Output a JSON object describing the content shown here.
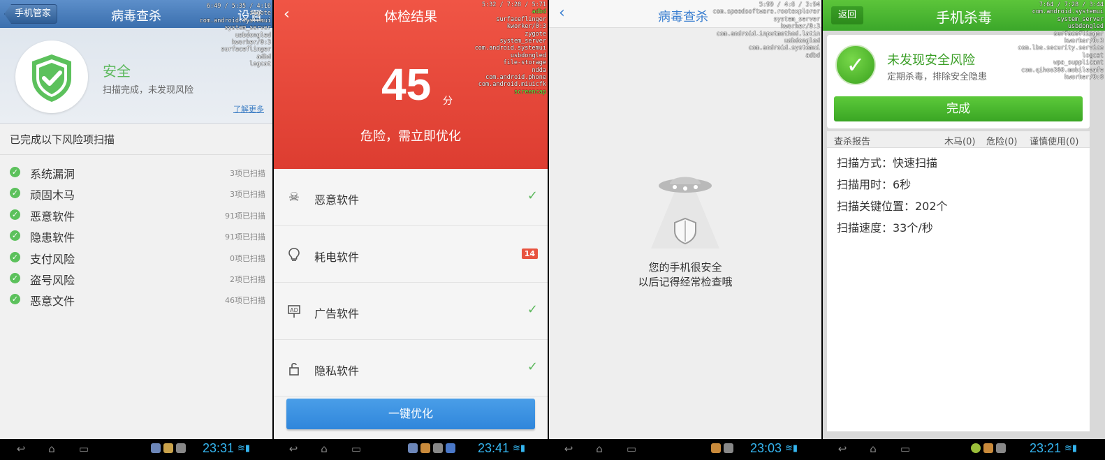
{
  "screen1": {
    "header": {
      "back_label": "手机管家",
      "title": "病毒查杀",
      "settings_label": "设置"
    },
    "debug": [
      "6:49 / 5:35 / 4:16",
      "zygote",
      "com.android.systemui",
      "system_server",
      "usbdongled",
      "kworker/0:3",
      "surfaceflinger",
      "adbd",
      "logcat"
    ],
    "status_title": "安全",
    "status_sub": "扫描完成，未发现风险",
    "learn_more": "了解更多",
    "section_title": "已完成以下风险项扫描",
    "items": [
      {
        "name": "系统漏洞",
        "count": "3项已扫描"
      },
      {
        "name": "顽固木马",
        "count": "3项已扫描"
      },
      {
        "name": "恶意软件",
        "count": "91项已扫描"
      },
      {
        "name": "隐患软件",
        "count": "91项已扫描"
      },
      {
        "name": "支付风险",
        "count": "0项已扫描"
      },
      {
        "name": "盗号风险",
        "count": "2项已扫描"
      },
      {
        "name": "恶意文件",
        "count": "46项已扫描"
      }
    ],
    "clock": "23:31"
  },
  "screen2": {
    "title": "体检结果",
    "debug": [
      "5:32 / 7:28 / 5:71",
      "adbd",
      "surfaceflinger",
      "kworker/0:3",
      "zygote",
      "system_server",
      "com.android.systemui",
      "usbdongled",
      "file-storage",
      "ndda",
      "com.android.phone",
      "com.android.miuicfk",
      "screencap"
    ],
    "score": "45",
    "score_unit": "分",
    "status": "危险，需立即优化",
    "rows": [
      {
        "name": "恶意软件",
        "icon": "skull-icon",
        "glyph": "☠",
        "state": "ok"
      },
      {
        "name": "耗电软件",
        "icon": "bulb-icon",
        "glyph": "💡",
        "state": "badge",
        "badge": "14"
      },
      {
        "name": "广告软件",
        "icon": "ad-sign-icon",
        "glyph": "⚑",
        "state": "ok"
      },
      {
        "name": "隐私软件",
        "icon": "lock-icon",
        "glyph": "🔓",
        "state": "ok"
      }
    ],
    "button": "一键优化",
    "clock": "23:41"
  },
  "screen3": {
    "title": "病毒查杀",
    "debug": [
      "5:99 / 4:6 / 3:94",
      "com.speedsoftware.rootexplorer",
      "system_server",
      "kworker/0:3",
      "com.android.inputmethod.latin",
      "usbdongled",
      "com.android.systemui",
      "adbd"
    ],
    "message_line1": "您的手机很安全",
    "message_line2": "以后记得经常检查哦",
    "clock": "23:03"
  },
  "screen4": {
    "header": {
      "back_label": "返回",
      "title": "手机杀毒"
    },
    "debug": [
      "7:64 / 7:28 / 3:44",
      "com.android.systemui",
      "system_server",
      "usbdongled",
      "surfaceflinger",
      "kworker/0:3",
      "com.lbe.security.service",
      "logcat",
      "wpa_supplicant",
      "com.qihoo360.mobilesafe",
      "kworker/0:0"
    ],
    "status_title": "未发现安全风险",
    "status_sub": "定期杀毒，排除安全隐患",
    "done_button": "完成",
    "report": {
      "label": "查杀报告",
      "trojan": "木马(0)",
      "danger": "危险(0)",
      "caution": "谨慎使用(0)",
      "lines": [
        "扫描方式：快速扫描",
        "扫描用时：6秒",
        "扫描关键位置：202个",
        "扫描速度：33个/秒"
      ]
    },
    "clock": "23:21"
  },
  "colors": {
    "blue_header": "#3a6fae",
    "red_hero": "#e84a3b",
    "green_header": "#3ba72a",
    "clock": "#35b6f0"
  }
}
